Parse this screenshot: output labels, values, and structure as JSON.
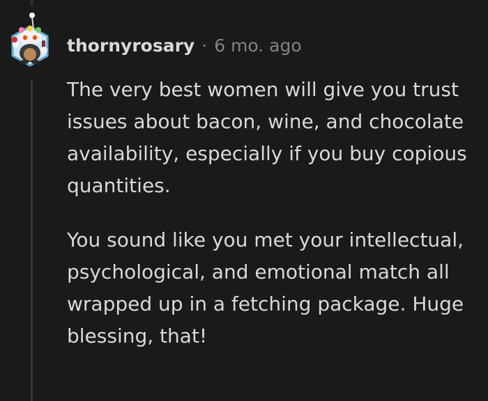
{
  "comment": {
    "author": "thornyrosary",
    "separator": "·",
    "timestamp": "6 mo. ago",
    "avatar_icon": "snoo-avatar-icon",
    "paragraphs": [
      "The very best women will give you trust issues about bacon, wine, and chocolate availability, especially if you buy copious quantities.",
      "You sound like you met your intellectual, psychological, and emotional match all wrapped up in a fetching package. Huge blessing, that!"
    ]
  },
  "colors": {
    "background": "#1a1a1b",
    "text": "#d7dadc",
    "meta": "#818384",
    "thread_line": "#343536"
  }
}
